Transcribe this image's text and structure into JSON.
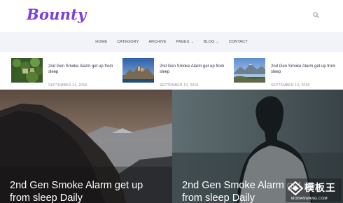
{
  "header": {
    "logo": "Bounty"
  },
  "nav": {
    "items": [
      {
        "label": "HOME"
      },
      {
        "label": "CATEGORY"
      },
      {
        "label": "ARCHIVE"
      },
      {
        "label": "PAGES"
      },
      {
        "label": "BLOG"
      },
      {
        "label": "CONTACT"
      }
    ]
  },
  "posts": [
    {
      "title": "2nd Gen Smoke Alarm get up from sleep",
      "date": "SEPTEMBER 14, 2018"
    },
    {
      "title": "2nd Gen Smoke Alarm get up from sleep",
      "date": "SEPTEMBER 14, 2018"
    },
    {
      "title": "2nd Gen Smoke Alarm get up from sleep",
      "date": "SEPTEMBER 14, 2018"
    }
  ],
  "hero": {
    "slides": [
      {
        "title": "2nd Gen Smoke Alarm get up from sleep Daily"
      },
      {
        "title": "2nd Gen Smoke Alarm get up from sleep Daily"
      }
    ]
  },
  "watermark": {
    "text": "模板王",
    "sub": "MOBANWANG.COM"
  },
  "colors": {
    "accent": "#7a3fdc",
    "nav_bg": "#f1f3f8",
    "text_dark": "#2e3240",
    "text_muted": "#8d91a2"
  }
}
